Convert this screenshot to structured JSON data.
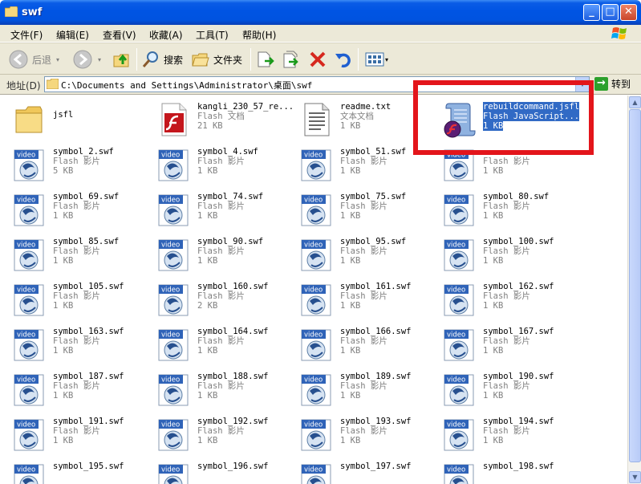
{
  "window": {
    "title": "swf"
  },
  "menu": [
    "文件(F)",
    "编辑(E)",
    "查看(V)",
    "收藏(A)",
    "工具(T)",
    "帮助(H)"
  ],
  "toolbar": {
    "back_label": "后退",
    "search_label": "搜索",
    "folders_label": "文件夹"
  },
  "address": {
    "label": "地址(D)",
    "path": "C:\\Documents and Settings\\Administrator\\桌面\\swf",
    "go_label": "转到"
  },
  "files": [
    {
      "name": "jsfl",
      "type": "",
      "size": "",
      "icon": "folder-icon"
    },
    {
      "name": "kangli_230_57_re...",
      "type": "Flash 文档",
      "size": "21 KB",
      "icon": "flash-document-icon"
    },
    {
      "name": "readme.txt",
      "type": "文本文档",
      "size": "1 KB",
      "icon": "text-document-icon"
    },
    {
      "name": "rebuildcommand.jsfl",
      "type": "Flash JavaScript...",
      "size": "1 KB",
      "icon": "jsfl-script-icon",
      "selected": true
    },
    {
      "name": "symbol_2.swf",
      "type": "Flash 影片",
      "size": "5 KB",
      "icon": "flash-movie-icon"
    },
    {
      "name": "symbol_4.swf",
      "type": "Flash 影片",
      "size": "1 KB",
      "icon": "flash-movie-icon"
    },
    {
      "name": "symbol_51.swf",
      "type": "Flash 影片",
      "size": "1 KB",
      "icon": "flash-movie-icon"
    },
    {
      "name": "",
      "type": "Flash 影片",
      "size": "1 KB",
      "icon": "flash-movie-icon"
    },
    {
      "name": "symbol_69.swf",
      "type": "Flash 影片",
      "size": "1 KB",
      "icon": "flash-movie-icon"
    },
    {
      "name": "symbol_74.swf",
      "type": "Flash 影片",
      "size": "1 KB",
      "icon": "flash-movie-icon"
    },
    {
      "name": "symbol_75.swf",
      "type": "Flash 影片",
      "size": "1 KB",
      "icon": "flash-movie-icon"
    },
    {
      "name": "symbol_80.swf",
      "type": "Flash 影片",
      "size": "1 KB",
      "icon": "flash-movie-icon"
    },
    {
      "name": "symbol_85.swf",
      "type": "Flash 影片",
      "size": "1 KB",
      "icon": "flash-movie-icon"
    },
    {
      "name": "symbol_90.swf",
      "type": "Flash 影片",
      "size": "1 KB",
      "icon": "flash-movie-icon"
    },
    {
      "name": "symbol_95.swf",
      "type": "Flash 影片",
      "size": "1 KB",
      "icon": "flash-movie-icon"
    },
    {
      "name": "symbol_100.swf",
      "type": "Flash 影片",
      "size": "1 KB",
      "icon": "flash-movie-icon"
    },
    {
      "name": "symbol_105.swf",
      "type": "Flash 影片",
      "size": "1 KB",
      "icon": "flash-movie-icon"
    },
    {
      "name": "symbol_160.swf",
      "type": "Flash 影片",
      "size": "2 KB",
      "icon": "flash-movie-icon"
    },
    {
      "name": "symbol_161.swf",
      "type": "Flash 影片",
      "size": "1 KB",
      "icon": "flash-movie-icon"
    },
    {
      "name": "symbol_162.swf",
      "type": "Flash 影片",
      "size": "1 KB",
      "icon": "flash-movie-icon"
    },
    {
      "name": "symbol_163.swf",
      "type": "Flash 影片",
      "size": "1 KB",
      "icon": "flash-movie-icon"
    },
    {
      "name": "symbol_164.swf",
      "type": "Flash 影片",
      "size": "1 KB",
      "icon": "flash-movie-icon"
    },
    {
      "name": "symbol_166.swf",
      "type": "Flash 影片",
      "size": "1 KB",
      "icon": "flash-movie-icon"
    },
    {
      "name": "symbol_167.swf",
      "type": "Flash 影片",
      "size": "1 KB",
      "icon": "flash-movie-icon"
    },
    {
      "name": "symbol_187.swf",
      "type": "Flash 影片",
      "size": "1 KB",
      "icon": "flash-movie-icon"
    },
    {
      "name": "symbol_188.swf",
      "type": "Flash 影片",
      "size": "1 KB",
      "icon": "flash-movie-icon"
    },
    {
      "name": "symbol_189.swf",
      "type": "Flash 影片",
      "size": "1 KB",
      "icon": "flash-movie-icon"
    },
    {
      "name": "symbol_190.swf",
      "type": "Flash 影片",
      "size": "1 KB",
      "icon": "flash-movie-icon"
    },
    {
      "name": "symbol_191.swf",
      "type": "Flash 影片",
      "size": "1 KB",
      "icon": "flash-movie-icon"
    },
    {
      "name": "symbol_192.swf",
      "type": "Flash 影片",
      "size": "1 KB",
      "icon": "flash-movie-icon"
    },
    {
      "name": "symbol_193.swf",
      "type": "Flash 影片",
      "size": "1 KB",
      "icon": "flash-movie-icon"
    },
    {
      "name": "symbol_194.swf",
      "type": "Flash 影片",
      "size": "1 KB",
      "icon": "flash-movie-icon"
    },
    {
      "name": "symbol_195.swf",
      "type": "",
      "size": "",
      "icon": "flash-movie-icon"
    },
    {
      "name": "symbol_196.swf",
      "type": "",
      "size": "",
      "icon": "flash-movie-icon"
    },
    {
      "name": "symbol_197.swf",
      "type": "",
      "size": "",
      "icon": "flash-movie-icon"
    },
    {
      "name": "symbol_198.swf",
      "type": "",
      "size": "",
      "icon": "flash-movie-icon"
    }
  ],
  "colors": {
    "titlebar": "#0054e3",
    "selection": "#316ac5",
    "highlight_box": "#e3151b",
    "chrome": "#ece9d8"
  }
}
